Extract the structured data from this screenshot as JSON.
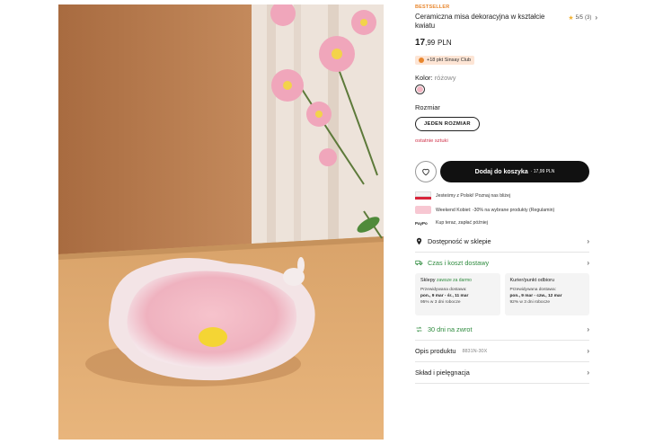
{
  "product": {
    "badge": "BESTSELLER",
    "title": "Ceramiczna misa dekoracyjna w kształcie kwiatu",
    "rating": "5/5",
    "rating_count": "(3)",
    "price_main": "17",
    "price_cents": ",99",
    "price_currency": "PLN",
    "club_points": "+18 pkt Sinsay Club",
    "color_label": "Kolor:",
    "color_value": "różowy",
    "size_label": "Rozmiar",
    "size_value": "JEDEN ROZMIAR",
    "stock_note": "ostatnie sztuki"
  },
  "actions": {
    "add_to_cart": "Dodaj do koszyka",
    "add_to_cart_price": "· 17,99 PLN"
  },
  "info": [
    {
      "icon": "poland-flag-icon",
      "text": "Jesteśmy z Polski! Poznaj nas bliżej"
    },
    {
      "icon": "promo-icon",
      "text": "Weekend Kobiet: -30% na wybrane produkty (Regulamin)"
    },
    {
      "icon": "paypo-icon",
      "icon_text": "PayPo",
      "text": "Kup teraz, zapłać później"
    }
  ],
  "menu": {
    "availability": "Dostępność w sklepie",
    "delivery": "Czas i koszt dostawy",
    "returns": "30 dni na zwrot",
    "description": "Opis produktu",
    "product_code": "8831N-30X",
    "care": "Skład i pielęgnacja"
  },
  "delivery_cards": [
    {
      "title": "Sklepy",
      "tag": "zawsze za darmo",
      "line1": "Przewidywana dostawa:",
      "line2": "pon., 9 mar - śr., 11 mar",
      "line3": "95% w 3 dni robocze"
    },
    {
      "title": "Kurier/punkt odbioru",
      "tag": "",
      "line1": "Przewidywana dostawa:",
      "line2": "pon., 9 mar - czw., 12 mar",
      "line3": "92% w 3 dni robocze"
    }
  ],
  "colors": {
    "accent": "#111111",
    "badge": "#e8862d",
    "alert": "#d0334a",
    "green": "#2e8b3e",
    "swatch": "#f1b6c3"
  }
}
